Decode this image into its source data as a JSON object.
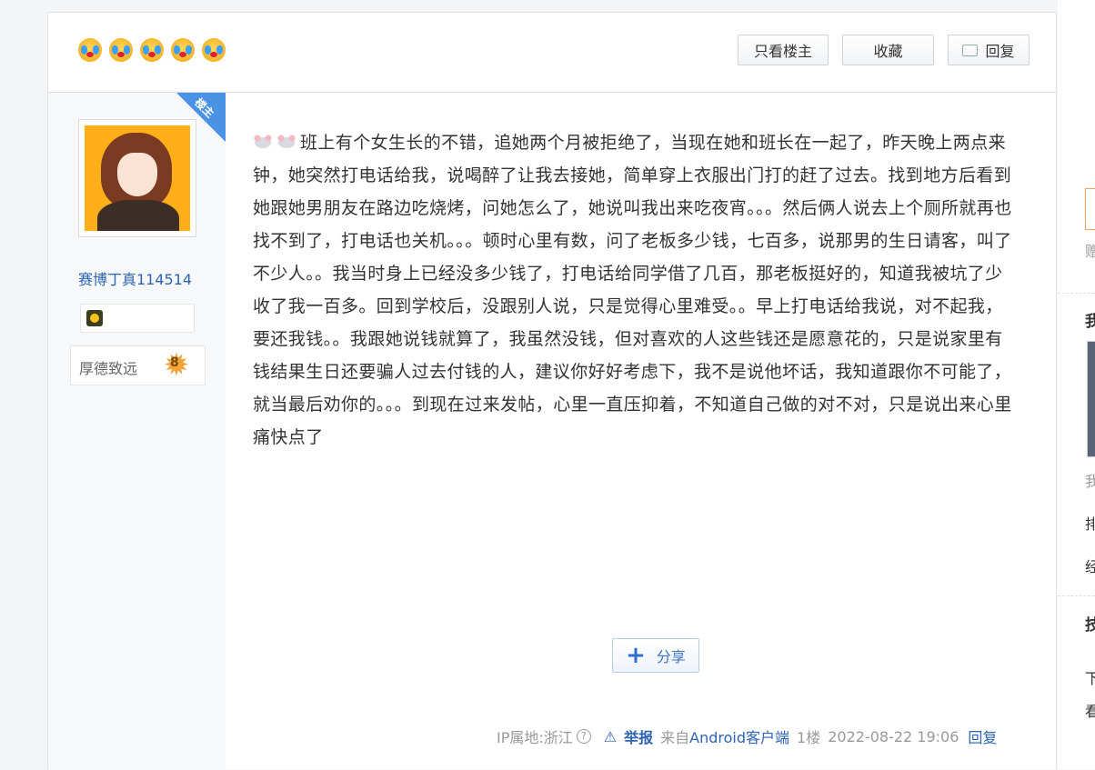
{
  "toolbar": {
    "only_author_label": "只看楼主",
    "favorite_label": "收藏",
    "reply_label": "回复"
  },
  "author": {
    "floor_badge": "楼主",
    "username": "赛博丁真114514",
    "level_title": "厚德致远",
    "level_number": "8"
  },
  "post": {
    "text": "班上有个女生长的不错，追她两个月被拒绝了，当现在她和班长在一起了，昨天晚上两点来钟，她突然打电话给我，说喝醉了让我去接她，简单穿上衣服出门打的赶了过去。找到地方后看到她跟她男朋友在路边吃烧烤，问她怎么了，她说叫我出来吃夜宵。。。然后俩人说去上个厕所就再也找不到了，打电话也关机。。。顿时心里有数，问了老板多少钱，七百多，说那男的生日请客，叫了不少人。。我当时身上已经没多少钱了，打电话给同学借了几百，那老板挺好的，知道我被坑了少收了我一百多。回到学校后，没跟别人说，只是觉得心里难受。。早上打电话给我说，对不起我，要还我钱。。我跟她说钱就算了，我虽然没钱，但对喜欢的人这些钱还是愿意花的，只是说家里有钱结果生日还要骗人过去付钱的人，建议你好好考虑下，我不是说他坏话，我知道跟你不可能了，就当最后劝你的。。。到现在过来发帖，心里一直压抑着，不知道自己做的对不对，只是说出来心里痛快点了",
    "share_label": "分享"
  },
  "footer": {
    "ip_location": "IP属地:浙江",
    "report_label": "举报",
    "source_prefix": "来自",
    "source_client": "Android客户端",
    "floor": "1楼",
    "timestamp": "2022-08-22 19:06",
    "reply_label": "回复"
  },
  "right_panel": {
    "t1": "赠",
    "h1": "我",
    "t2": "我",
    "t3": "排",
    "t4": "经",
    "h2": "技",
    "t5": "下",
    "t6": "看"
  },
  "icons": {
    "emoji_row": "crying-face-icon",
    "reply": "comment-icon",
    "help": "question-circle-icon",
    "report": "warning-triangle-icon",
    "share": "plus-icon",
    "post_emoji": "mouse-face-icon"
  },
  "colors": {
    "link": "#2d64b3",
    "floor_badge": "#4a92e3",
    "level_star": "#f2a33a"
  }
}
